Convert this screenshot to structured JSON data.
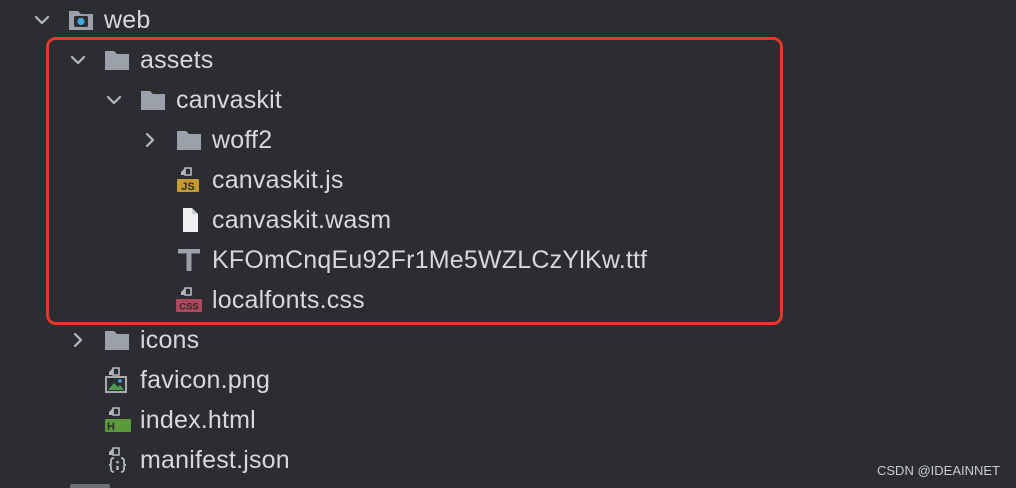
{
  "tree": {
    "web": {
      "label": "web",
      "icon": "web-module-folder-icon",
      "expanded": true
    },
    "assets": {
      "label": "assets",
      "icon": "folder-icon",
      "expanded": true
    },
    "canvaskit_dir": {
      "label": "canvaskit",
      "icon": "folder-icon",
      "expanded": true
    },
    "woff2": {
      "label": "woff2",
      "icon": "folder-icon",
      "expanded": false
    },
    "canvaskit_js": {
      "label": "canvaskit.js",
      "icon": "javascript-file-icon",
      "badge": "JS"
    },
    "canvaskit_wasm": {
      "label": "canvaskit.wasm",
      "icon": "generic-file-icon"
    },
    "font_ttf": {
      "label": "KFOmCnqEu92Fr1Me5WZLCzYlKw.ttf",
      "icon": "font-file-icon"
    },
    "localfonts_css": {
      "label": "localfonts.css",
      "icon": "css-file-icon",
      "badge": "CSS"
    },
    "icons": {
      "label": "icons",
      "icon": "folder-icon",
      "expanded": false
    },
    "favicon": {
      "label": "favicon.png",
      "icon": "image-file-icon"
    },
    "index_html": {
      "label": "index.html",
      "icon": "html-file-icon",
      "badge": "H"
    },
    "manifest": {
      "label": "manifest.json",
      "icon": "json-file-icon"
    }
  },
  "watermark": "CSDN @IDEAINNET",
  "colors": {
    "background": "#2b2d30",
    "text": "#d6d8dc",
    "folder": "#9aa1ab",
    "highlight_border": "#e3382b",
    "js_badge": "#c79a33",
    "css_badge": "#b0485d",
    "html_badge": "#5a9a3a"
  }
}
